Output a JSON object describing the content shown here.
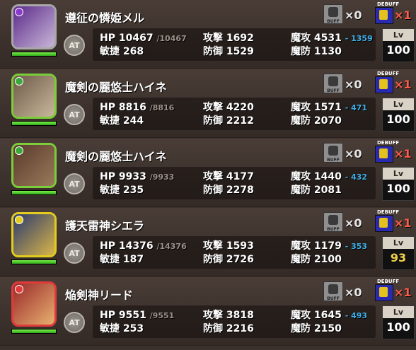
{
  "labels": {
    "hp": "HP",
    "speed": "敏捷",
    "atk": "攻撃",
    "def": "防御",
    "matk": "魔攻",
    "mdef": "魔防",
    "at": "AT",
    "lv": "Lv",
    "buff": "BUFF",
    "debuff": "DEBUFF"
  },
  "units": [
    {
      "name": "遵征の憐姫メル",
      "frame": "#a8a8a8",
      "element": "#8a3cc8",
      "portrait": [
        "#5b2a8a",
        "#c9b6d8"
      ],
      "hp": "10467",
      "hp_max": "/10467",
      "hp_fill": 1.0,
      "speed": "268",
      "atk": "1692",
      "def": "1529",
      "matk": "4531",
      "matk_bonus": "- 1359",
      "mdef": "1130",
      "buff_count": "×0",
      "debuff_count": "×1",
      "lv": "100",
      "lv_color": "#ffffff"
    },
    {
      "name": "魔剣の麗悠士ハイネ",
      "frame": "#7ccd3a",
      "element": "#3aa83a",
      "portrait": [
        "#6e5a48",
        "#c9b89c"
      ],
      "hp": "8816",
      "hp_max": "/8816",
      "hp_fill": 1.0,
      "speed": "244",
      "atk": "4220",
      "def": "2212",
      "matk": "1571",
      "matk_bonus": "- 471",
      "mdef": "2070",
      "buff_count": "×0",
      "debuff_count": "×1",
      "lv": "100",
      "lv_color": "#ffffff"
    },
    {
      "name": "魔剣の麗悠士ハイネ",
      "frame": "#7ccd3a",
      "element": "#3aa83a",
      "portrait": [
        "#5a3a2c",
        "#9a7a5a"
      ],
      "hp": "9933",
      "hp_max": "/9933",
      "hp_fill": 1.0,
      "speed": "235",
      "atk": "4177",
      "def": "2278",
      "matk": "1440",
      "matk_bonus": "- 432",
      "mdef": "2081",
      "buff_count": "×0",
      "debuff_count": "×1",
      "lv": "100",
      "lv_color": "#ffffff"
    },
    {
      "name": "護天雷神シエラ",
      "frame": "#e2cc1e",
      "element": "#e2cc1e",
      "portrait": [
        "#2b3a6e",
        "#d9b548"
      ],
      "hp": "14376",
      "hp_max": "/14376",
      "hp_fill": 1.0,
      "speed": "187",
      "atk": "1593",
      "def": "2726",
      "matk": "1179",
      "matk_bonus": "- 353",
      "mdef": "2100",
      "buff_count": "×0",
      "debuff_count": "×1",
      "lv": "93",
      "lv_color": "#f2d44a"
    },
    {
      "name": "焔剣神リード",
      "frame": "#e03a3a",
      "element": "#e03a3a",
      "portrait": [
        "#9a2a2a",
        "#e8b070"
      ],
      "hp": "9551",
      "hp_max": "/9551",
      "hp_fill": 1.0,
      "speed": "253",
      "atk": "3818",
      "def": "2216",
      "matk": "1645",
      "matk_bonus": "- 493",
      "mdef": "2150",
      "buff_count": "×0",
      "debuff_count": "×1",
      "lv": "100",
      "lv_color": "#ffffff"
    }
  ]
}
